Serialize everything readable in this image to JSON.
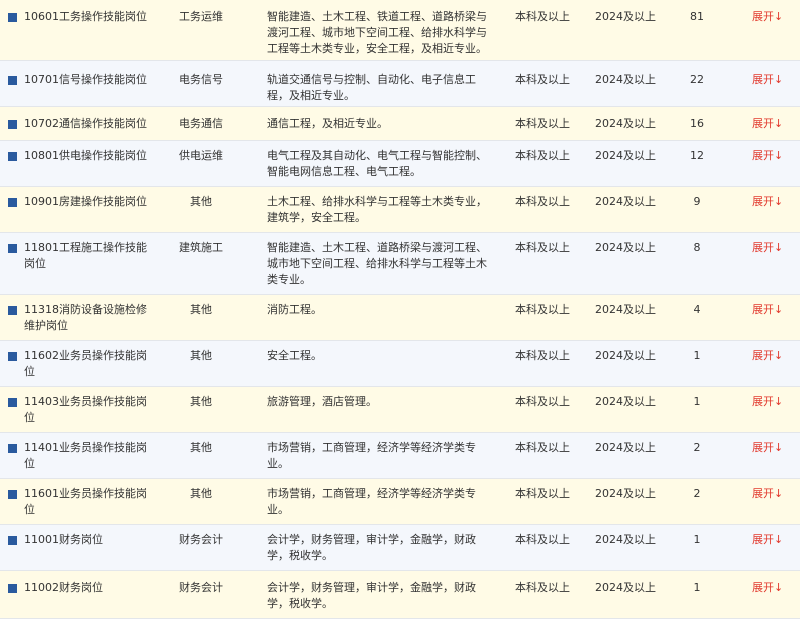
{
  "rows": [
    {
      "name": "10601工务操作技能岗位",
      "category": "工务运维",
      "major": "智能建造、土木工程、铁道工程、道路桥梁与渡河工程、城市地下空间工程、给排水科学与工程等土木类专业，安全工程，及相近专业。",
      "education": "本科及以上",
      "year": "2024及以上",
      "count": "81",
      "expand": "展开↓"
    },
    {
      "name": "10701信号操作技能岗位",
      "category": "电务信号",
      "major": "轨道交通信号与控制、自动化、电子信息工程，及相近专业。",
      "education": "本科及以上",
      "year": "2024及以上",
      "count": "22",
      "expand": "展开↓"
    },
    {
      "name": "10702通信操作技能岗位",
      "category": "电务通信",
      "major": "通信工程，及相近专业。",
      "education": "本科及以上",
      "year": "2024及以上",
      "count": "16",
      "expand": "展开↓"
    },
    {
      "name": "10801供电操作技能岗位",
      "category": "供电运维",
      "major": "电气工程及其自动化、电气工程与智能控制、智能电网信息工程、电气工程。",
      "education": "本科及以上",
      "year": "2024及以上",
      "count": "12",
      "expand": "展开↓"
    },
    {
      "name": "10901房建操作技能岗位",
      "category": "其他",
      "major": "土木工程、给排水科学与工程等土木类专业，建筑学，安全工程。",
      "education": "本科及以上",
      "year": "2024及以上",
      "count": "9",
      "expand": "展开↓"
    },
    {
      "name": "11801工程施工操作技能岗位",
      "category": "建筑施工",
      "major": "智能建造、土木工程、道路桥梁与渡河工程、城市地下空间工程、给排水科学与工程等土木类专业。",
      "education": "本科及以上",
      "year": "2024及以上",
      "count": "8",
      "expand": "展开↓"
    },
    {
      "name": "11318消防设备设施检修维护岗位",
      "category": "其他",
      "major": "消防工程。",
      "education": "本科及以上",
      "year": "2024及以上",
      "count": "4",
      "expand": "展开↓"
    },
    {
      "name": "11602业务员操作技能岗位",
      "category": "其他",
      "major": "安全工程。",
      "education": "本科及以上",
      "year": "2024及以上",
      "count": "1",
      "expand": "展开↓"
    },
    {
      "name": "11403业务员操作技能岗位",
      "category": "其他",
      "major": "旅游管理，酒店管理。",
      "education": "本科及以上",
      "year": "2024及以上",
      "count": "1",
      "expand": "展开↓"
    },
    {
      "name": "11401业务员操作技能岗位",
      "category": "其他",
      "major": "市场营销，工商管理，经济学等经济学类专业。",
      "education": "本科及以上",
      "year": "2024及以上",
      "count": "2",
      "expand": "展开↓"
    },
    {
      "name": "11601业务员操作技能岗位",
      "category": "其他",
      "major": "市场营销，工商管理，经济学等经济学类专业。",
      "education": "本科及以上",
      "year": "2024及以上",
      "count": "2",
      "expand": "展开↓"
    },
    {
      "name": "11001财务岗位",
      "category": "财务会计",
      "major": "会计学，财务管理，审计学，金融学，财政学，税收学。",
      "education": "本科及以上",
      "year": "2024及以上",
      "count": "1",
      "expand": "展开↓"
    },
    {
      "name": "11002财务岗位",
      "category": "财务会计",
      "major": "会计学，财务管理，审计学，金融学，财政学，税收学。",
      "education": "本科及以上",
      "year": "2024及以上",
      "count": "1",
      "expand": "展开↓"
    }
  ]
}
